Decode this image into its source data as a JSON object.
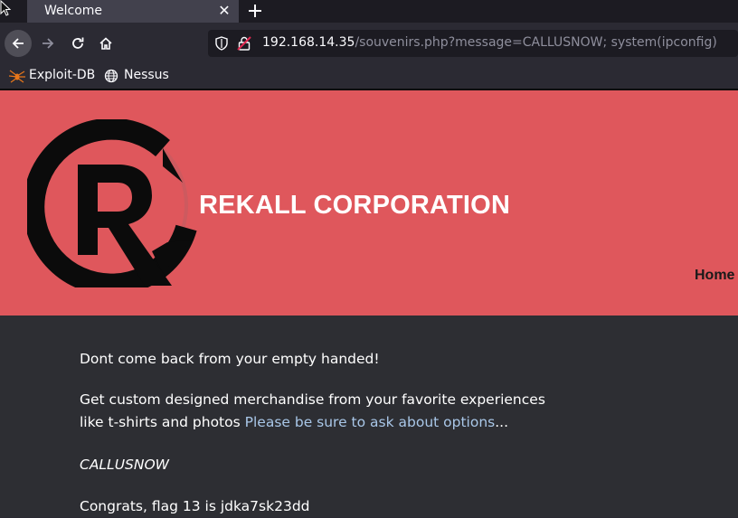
{
  "browser": {
    "tab_title": "Welcome",
    "tab_close": "✕",
    "new_tab": "+",
    "url_host": "192.168.14.35",
    "url_path": "/souvenirs.php?message=CALLUSNOW; system(ipconfig)",
    "bookmarks": [
      {
        "label": "Exploit-DB",
        "icon": "spider-icon"
      },
      {
        "label": "Nessus",
        "icon": "globe-icon"
      }
    ]
  },
  "header": {
    "brand": "REKALL CORPORATION",
    "nav_home": "Home",
    "accent_color": "#df575c"
  },
  "main": {
    "line1": "Dont come back from your empty handed!",
    "line2_text": "Get custom designed merchandise from your favorite experiences like t-shirts and photos ",
    "line2_link": "Please be sure to ask about options",
    "line2_suffix": "...",
    "message": "CALLUSNOW",
    "flag": "Congrats, flag 13 is jdka7sk23dd"
  }
}
